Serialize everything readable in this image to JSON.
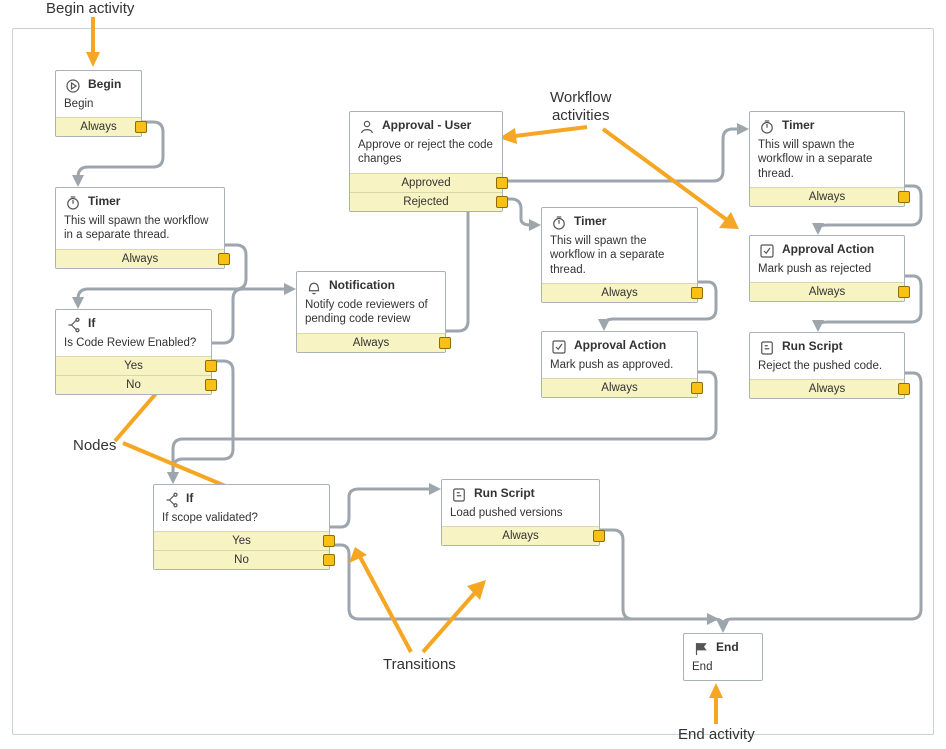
{
  "annotations": {
    "begin": "Begin activity",
    "workflow": "Workflow activities",
    "nodes": "Nodes",
    "transitions": "Transitions",
    "end": "End activity"
  },
  "nodes": {
    "begin": {
      "title": "Begin",
      "desc": "Begin",
      "outcomes": [
        "Always"
      ]
    },
    "timer1": {
      "title": "Timer",
      "desc": "This will spawn the workflow in a separate thread.",
      "outcomes": [
        "Always"
      ]
    },
    "if1": {
      "title": "If",
      "desc": "Is Code Review Enabled?",
      "outcomes": [
        "Yes",
        "No"
      ]
    },
    "notification": {
      "title": "Notification",
      "desc": "Notify code reviewers of pending code review",
      "outcomes": [
        "Always"
      ]
    },
    "approval_user": {
      "title": "Approval - User",
      "desc": "Approve or reject the code changes",
      "outcomes": [
        "Approved",
        "Rejected"
      ]
    },
    "timer2": {
      "title": "Timer",
      "desc": "This will spawn the workflow in a separate thread.",
      "outcomes": [
        "Always"
      ]
    },
    "timer3": {
      "title": "Timer",
      "desc": "This will spawn the workflow in a separate thread.",
      "outcomes": [
        "Always"
      ]
    },
    "approval_ok": {
      "title": "Approval Action",
      "desc": "Mark push as approved.",
      "outcomes": [
        "Always"
      ]
    },
    "approval_rej": {
      "title": "Approval Action",
      "desc": "Mark push as rejected",
      "outcomes": [
        "Always"
      ]
    },
    "runscript_rej": {
      "title": "Run Script",
      "desc": "Reject the pushed code.",
      "outcomes": [
        "Always"
      ]
    },
    "if2": {
      "title": "If",
      "desc": "If scope validated?",
      "outcomes": [
        "Yes",
        "No"
      ]
    },
    "runscript_ld": {
      "title": "Run Script",
      "desc": "Load pushed versions",
      "outcomes": [
        "Always"
      ]
    },
    "end": {
      "title": "End",
      "desc": "End",
      "outcomes": []
    }
  }
}
